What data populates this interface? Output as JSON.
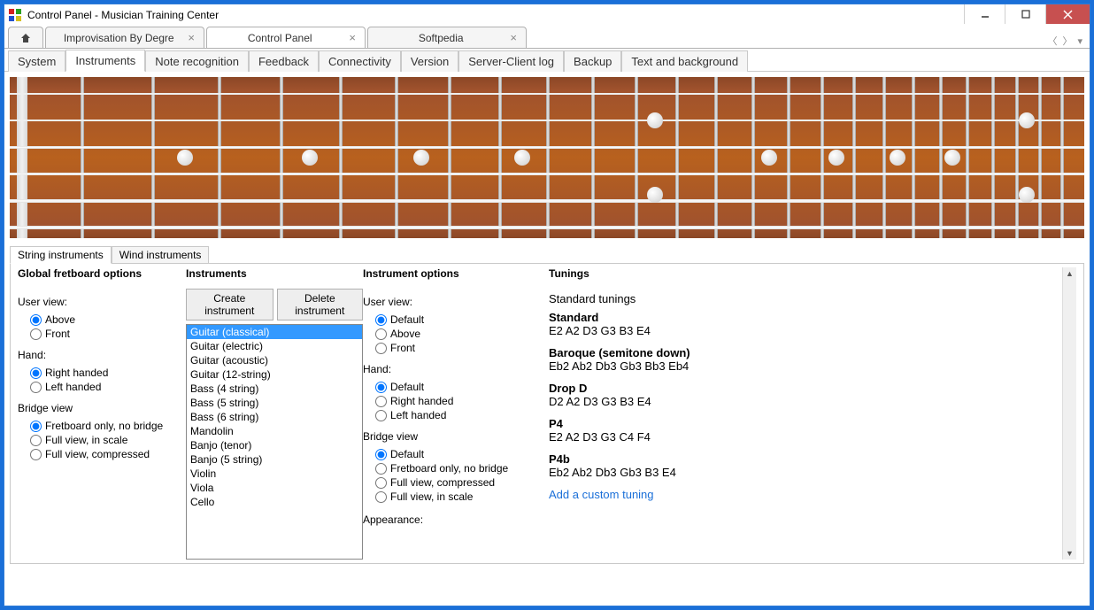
{
  "window": {
    "title": "Control Panel - Musician Training Center"
  },
  "maintabs": [
    {
      "label": "Improvisation By Degre",
      "active": false
    },
    {
      "label": "Control Panel",
      "active": true
    },
    {
      "label": "Softpedia",
      "active": false
    }
  ],
  "subtabs": [
    "System",
    "Instruments",
    "Note recognition",
    "Feedback",
    "Connectivity",
    "Version",
    "Server-Client log",
    "Backup",
    "Text and background"
  ],
  "active_subtab": "Instruments",
  "lower_tabs": [
    "String instruments",
    "Wind instruments"
  ],
  "active_lower_tab": "String instruments",
  "columns": {
    "global": {
      "heading": "Global fretboard options",
      "userview_label": "User view:",
      "userview_options": [
        "Above",
        "Front"
      ],
      "userview_selected": "Above",
      "hand_label": "Hand:",
      "hand_options": [
        "Right handed",
        "Left handed"
      ],
      "hand_selected": "Right handed",
      "bridge_label": "Bridge view",
      "bridge_options": [
        "Fretboard only, no bridge",
        "Full view, in scale",
        "Full view, compressed"
      ],
      "bridge_selected": "Fretboard only, no bridge"
    },
    "instruments": {
      "heading": "Instruments",
      "create_btn": "Create instrument",
      "delete_btn": "Delete instrument",
      "list": [
        "Guitar (classical)",
        "Guitar (electric)",
        "Guitar (acoustic)",
        "Guitar (12-string)",
        "Bass (4 string)",
        "Bass (5 string)",
        "Bass (6 string)",
        "Mandolin",
        "Banjo (tenor)",
        "Banjo (5 string)",
        "Violin",
        "Viola",
        "Cello"
      ],
      "selected": "Guitar (classical)"
    },
    "options": {
      "heading": "Instrument options",
      "userview_label": "User view:",
      "userview_options": [
        "Default",
        "Above",
        "Front"
      ],
      "userview_selected": "Default",
      "hand_label": "Hand:",
      "hand_options": [
        "Default",
        "Right handed",
        "Left handed"
      ],
      "hand_selected": "Default",
      "bridge_label": "Bridge view",
      "bridge_options": [
        "Default",
        "Fretboard only, no bridge",
        "Full view, compressed",
        "Full view, in scale"
      ],
      "bridge_selected": "Default",
      "appearance_label": "Appearance:"
    },
    "tunings": {
      "heading": "Tunings",
      "section_label": "Standard tunings",
      "items": [
        {
          "name": "Standard",
          "notes": "E2 A2 D3 G3 B3 E4"
        },
        {
          "name": "Baroque (semitone down)",
          "notes": "Eb2 Ab2 Db3 Gb3 Bb3 Eb4"
        },
        {
          "name": "Drop D",
          "notes": "D2 A2 D3 G3 B3 E4"
        },
        {
          "name": "P4",
          "notes": "E2 A2 D3 G3 C4 F4"
        },
        {
          "name": "P4b",
          "notes": "Eb2 Ab2 Db3 Gb3 B3 E4"
        }
      ],
      "add_link": "Add a custom tuning"
    }
  }
}
